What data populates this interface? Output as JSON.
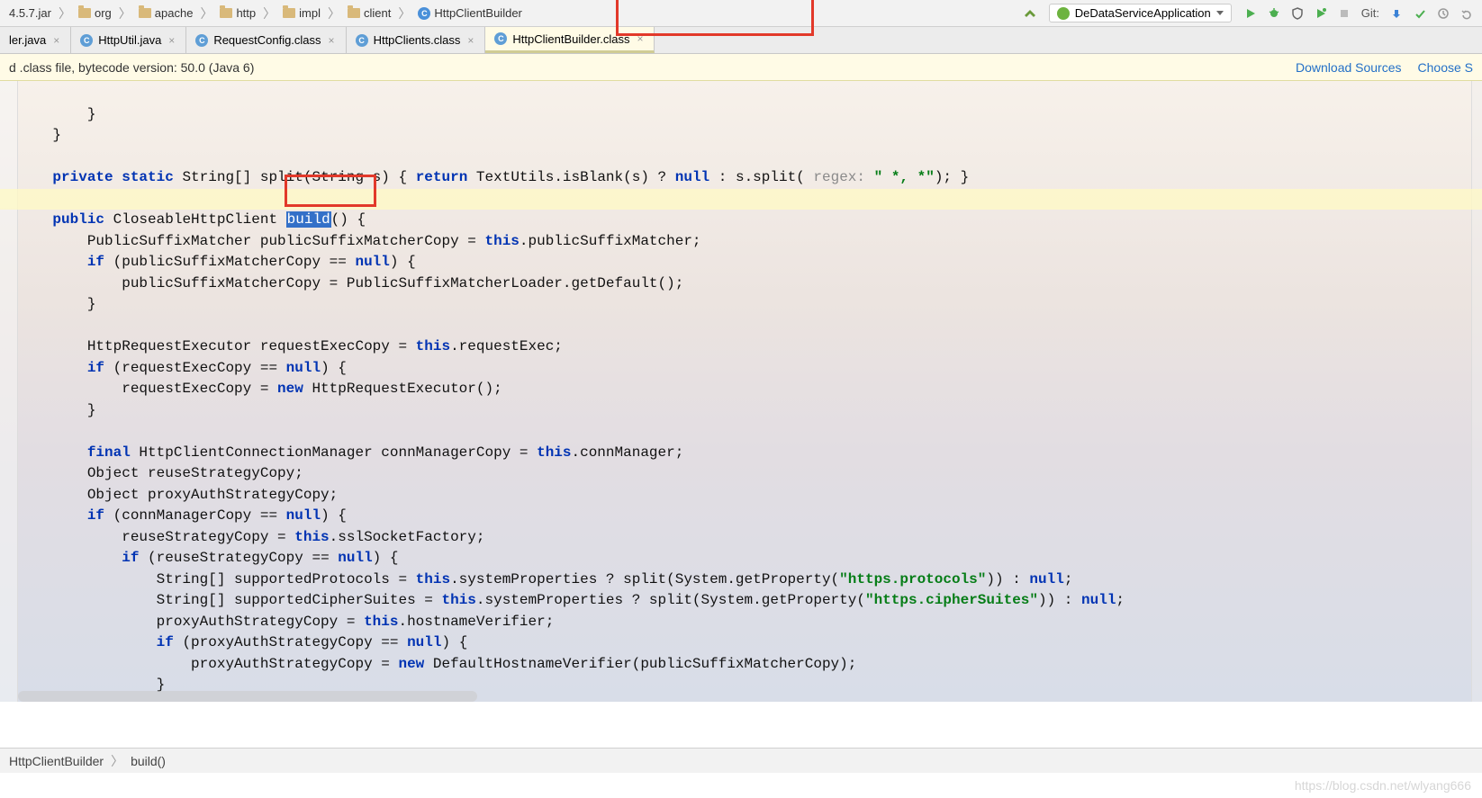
{
  "breadcrumb": [
    {
      "label": "4.5.7.jar",
      "icon": "jar"
    },
    {
      "label": "org",
      "icon": "folder"
    },
    {
      "label": "apache",
      "icon": "folder"
    },
    {
      "label": "http",
      "icon": "folder"
    },
    {
      "label": "impl",
      "icon": "folder"
    },
    {
      "label": "client",
      "icon": "folder"
    },
    {
      "label": "HttpClientBuilder",
      "icon": "class"
    }
  ],
  "run_config": {
    "label": "DeDataServiceApplication"
  },
  "git_label": "Git:",
  "tabs": [
    {
      "label": "ler.java",
      "icon": "java",
      "active": false
    },
    {
      "label": "HttpUtil.java",
      "icon": "java",
      "active": false
    },
    {
      "label": "RequestConfig.class",
      "icon": "class",
      "active": false
    },
    {
      "label": "HttpClients.class",
      "icon": "class",
      "active": false
    },
    {
      "label": "HttpClientBuilder.class",
      "icon": "class",
      "active": true
    }
  ],
  "infobar": {
    "text": "d .class file, bytecode version: 50.0 (Java 6)",
    "link1": "Download Sources",
    "link2": "Choose S"
  },
  "code": {
    "l1": "        }",
    "l2": "    }",
    "l3": "",
    "l4a": "    private static ",
    "l4b": "String[] split(String s) { ",
    "l4c": "return ",
    "l4d": "TextUtils.isBlank(s) ? ",
    "l4e": "null ",
    "l4f": ": s.split( ",
    "l4hint": "regex: ",
    "l4g": "\" *, *\"",
    "l4h": "); }",
    "l5": "",
    "l6a": "    public ",
    "l6b": "CloseableHttpClient ",
    "l6sel": "build",
    "l6c": "() {",
    "l7a": "        PublicSuffixMatcher publicSuffixMatcherCopy = ",
    "l7b": "this",
    "l7c": ".publicSuffixMatcher;",
    "l8a": "        if ",
    "l8b": "(publicSuffixMatcherCopy == ",
    "l8c": "null",
    "l8d": ") {",
    "l9": "            publicSuffixMatcherCopy = PublicSuffixMatcherLoader.getDefault();",
    "l10": "        }",
    "l11": "",
    "l12a": "        HttpRequestExecutor requestExecCopy = ",
    "l12b": "this",
    "l12c": ".requestExec;",
    "l13a": "        if ",
    "l13b": "(requestExecCopy == ",
    "l13c": "null",
    "l13d": ") {",
    "l14a": "            requestExecCopy = ",
    "l14b": "new ",
    "l14c": "HttpRequestExecutor();",
    "l15": "        }",
    "l16": "",
    "l17a": "        final ",
    "l17b": "HttpClientConnectionManager connManagerCopy = ",
    "l17c": "this",
    "l17d": ".connManager;",
    "l18": "        Object reuseStrategyCopy;",
    "l19": "        Object proxyAuthStrategyCopy;",
    "l20a": "        if ",
    "l20b": "(connManagerCopy == ",
    "l20c": "null",
    "l20d": ") {",
    "l21a": "            reuseStrategyCopy = ",
    "l21b": "this",
    "l21c": ".sslSocketFactory;",
    "l22a": "            if ",
    "l22b": "(reuseStrategyCopy == ",
    "l22c": "null",
    "l22d": ") {",
    "l23a": "                String[] supportedProtocols = ",
    "l23b": "this",
    "l23c": ".systemProperties ? split(System.getProperty(",
    "l23d": "\"https.protocols\"",
    "l23e": ")) : ",
    "l23f": "null",
    "l23g": ";",
    "l24a": "                String[] supportedCipherSuites = ",
    "l24b": "this",
    "l24c": ".systemProperties ? split(System.getProperty(",
    "l24d": "\"https.cipherSuites\"",
    "l24e": ")) : ",
    "l24f": "null",
    "l24g": ";",
    "l25a": "                proxyAuthStrategyCopy = ",
    "l25b": "this",
    "l25c": ".hostnameVerifier;",
    "l26a": "                if ",
    "l26b": "(proxyAuthStrategyCopy == ",
    "l26c": "null",
    "l26d": ") {",
    "l27a": "                    proxyAuthStrategyCopy = ",
    "l27b": "new ",
    "l27c": "DefaultHostnameVerifier(publicSuffixMatcherCopy);",
    "l28": "                }"
  },
  "bottom_crumb": {
    "c1": "HttpClientBuilder",
    "c2": "build()"
  },
  "watermark": "https://blog.csdn.net/wlyang666"
}
